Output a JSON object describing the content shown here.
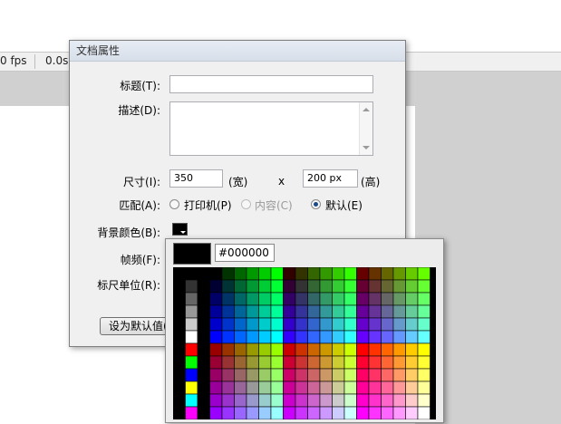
{
  "status": {
    "fps": "0 fps",
    "time": "0.0s"
  },
  "dialog": {
    "title": "文档属性",
    "labels": {
      "title": "标题(T):",
      "description": "描述(D):",
      "size": "尺寸(I):",
      "width_unit": "(宽)",
      "x": "x",
      "height_unit": "(高)",
      "match": "匹配(A):",
      "background": "背景颜色(B):",
      "framerate": "帧频(F):",
      "ruler": "标尺单位(R):"
    },
    "title_value": "",
    "description_value": "",
    "width_value": "350",
    "height_value": "200 px",
    "match_options": [
      {
        "label": "打印机(P)",
        "selected": false,
        "disabled": false
      },
      {
        "label": "内容(C)",
        "selected": false,
        "disabled": true
      },
      {
        "label": "默认(E)",
        "selected": true,
        "disabled": false
      }
    ],
    "background_color": "#000000",
    "default_button": "设为默认值(M)"
  },
  "picker": {
    "hex_value": "#000000"
  }
}
